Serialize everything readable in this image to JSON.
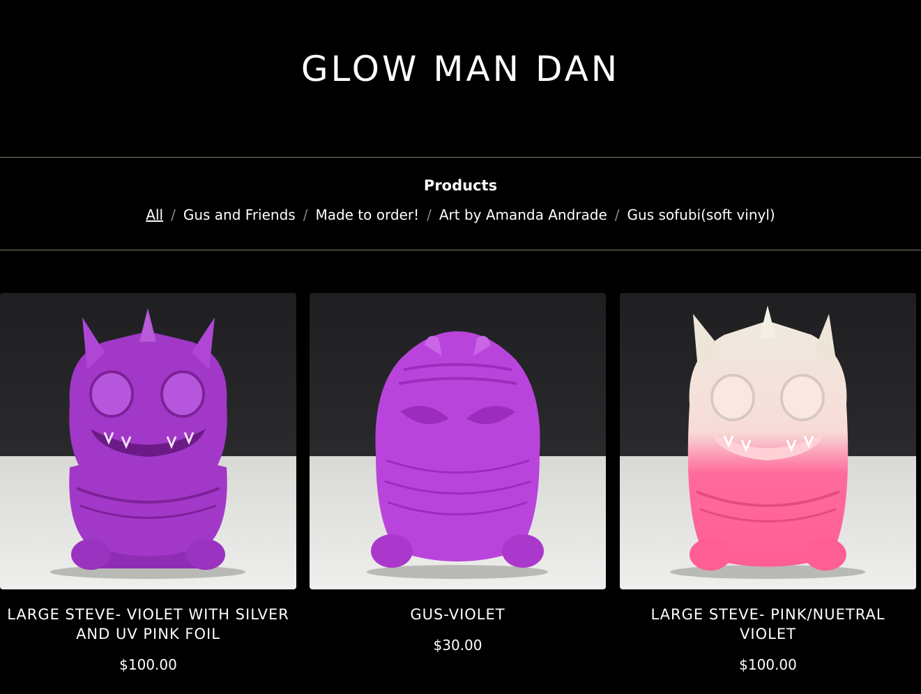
{
  "site": {
    "title": "GLOW MAN DAN"
  },
  "catalog": {
    "heading": "Products",
    "categories": [
      {
        "label": "All",
        "active": true
      },
      {
        "label": "Gus and Friends",
        "active": false
      },
      {
        "label": "Made to order!",
        "active": false
      },
      {
        "label": "Art by Amanda Andrade",
        "active": false
      },
      {
        "label": "Gus sofubi(soft vinyl)",
        "active": false
      }
    ],
    "separator": "/"
  },
  "products": [
    {
      "name": "LARGE STEVE- VIOLET WITH SILVER AND UV PINK FOIL",
      "price": "$100.00",
      "image": "purple-horned-monster-figure",
      "colors": {
        "body": "#a238c8",
        "top": "#a238c8"
      }
    },
    {
      "name": "GUS-VIOLET",
      "price": "$30.00",
      "image": "purple-round-monster-figure",
      "colors": {
        "body": "#b944db",
        "top": "#b944db"
      }
    },
    {
      "name": "LARGE STEVE- PINK/NUETRAL VIOLET",
      "price": "$100.00",
      "image": "pink-white-horned-monster-figure",
      "colors": {
        "body": "#ff5e95",
        "top": "#efeadf"
      }
    }
  ]
}
